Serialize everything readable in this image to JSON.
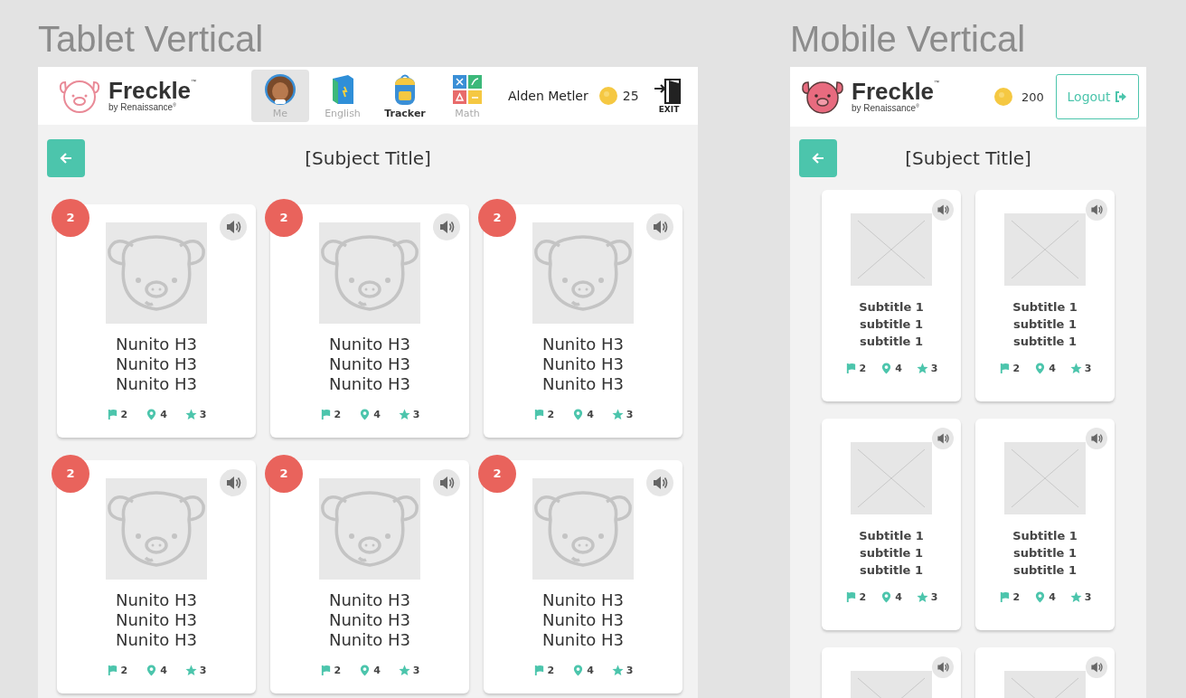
{
  "tablet": {
    "heading": "Tablet Vertical",
    "logo": {
      "kind": "outline",
      "name": "Freckle",
      "mark": "$^{™}$",
      "tagline": "by Renaissance$^{®}$"
    },
    "nav": [
      {
        "kind": "avatar",
        "label": "Me",
        "selected": true,
        "emphasized": false
      },
      {
        "kind": "book",
        "label": "English",
        "selected": false,
        "emphasized": false
      },
      {
        "kind": "backpack",
        "label": "Tracker",
        "selected": false,
        "emphasized": true
      },
      {
        "kind": "math",
        "label": "Math",
        "selected": false,
        "emphasized": false
      }
    ],
    "user_name": "Alden Metler",
    "coins": "25",
    "exit_label": "EXIT",
    "title": "[Subject Title]",
    "cards": [
      {
        "badge": "2",
        "lines": [
          "Nunito H3",
          "Nunito H3",
          "Nunito H3"
        ],
        "stats": [
          {
            "kind": "flag",
            "value": "2"
          },
          {
            "kind": "pin",
            "value": "4"
          },
          {
            "kind": "star",
            "value": "3"
          }
        ]
      },
      {
        "badge": "2",
        "lines": [
          "Nunito H3",
          "Nunito H3",
          "Nunito H3"
        ],
        "stats": [
          {
            "kind": "flag",
            "value": "2"
          },
          {
            "kind": "pin",
            "value": "4"
          },
          {
            "kind": "star",
            "value": "3"
          }
        ]
      },
      {
        "badge": "2",
        "lines": [
          "Nunito H3",
          "Nunito H3",
          "Nunito H3"
        ],
        "stats": [
          {
            "kind": "flag",
            "value": "2"
          },
          {
            "kind": "pin",
            "value": "4"
          },
          {
            "kind": "star",
            "value": "3"
          }
        ]
      },
      {
        "badge": "2",
        "lines": [
          "Nunito H3",
          "Nunito H3",
          "Nunito H3"
        ],
        "stats": [
          {
            "kind": "flag",
            "value": "2"
          },
          {
            "kind": "pin",
            "value": "4"
          },
          {
            "kind": "star",
            "value": "3"
          }
        ]
      },
      {
        "badge": "2",
        "lines": [
          "Nunito H3",
          "Nunito H3",
          "Nunito H3"
        ],
        "stats": [
          {
            "kind": "flag",
            "value": "2"
          },
          {
            "kind": "pin",
            "value": "4"
          },
          {
            "kind": "star",
            "value": "3"
          }
        ]
      },
      {
        "badge": "2",
        "lines": [
          "Nunito H3",
          "Nunito H3",
          "Nunito H3"
        ],
        "stats": [
          {
            "kind": "flag",
            "value": "2"
          },
          {
            "kind": "pin",
            "value": "4"
          },
          {
            "kind": "star",
            "value": "3"
          }
        ]
      }
    ]
  },
  "mobile": {
    "heading": "Mobile Vertical",
    "logo": {
      "kind": "filled",
      "name": "Freckle",
      "mark": "$^{™}$",
      "tagline": "by Renaissance$^{®}$"
    },
    "coins": "200",
    "logout_label": "Logout",
    "title": "[Subject Title]",
    "cards": [
      {
        "kind": "subtitled",
        "lines": [
          "Subtitle 1",
          "subtitle 1",
          "subtitle 1"
        ],
        "stats": [
          {
            "kind": "flag",
            "value": "2"
          },
          {
            "kind": "pin",
            "value": "4"
          },
          {
            "kind": "star",
            "value": "3"
          }
        ]
      },
      {
        "kind": "subtitled",
        "lines": [
          "Subtitle 1",
          "subtitle 1",
          "subtitle 1"
        ],
        "stats": [
          {
            "kind": "flag",
            "value": "2"
          },
          {
            "kind": "pin",
            "value": "4"
          },
          {
            "kind": "star",
            "value": "3"
          }
        ]
      },
      {
        "kind": "subtitled",
        "lines": [
          "Subtitle 1",
          "subtitle 1",
          "subtitle 1"
        ],
        "stats": [
          {
            "kind": "flag",
            "value": "2"
          },
          {
            "kind": "pin",
            "value": "4"
          },
          {
            "kind": "star",
            "value": "3"
          }
        ]
      },
      {
        "kind": "subtitled",
        "lines": [
          "Subtitle 1",
          "subtitle 1",
          "subtitle 1"
        ],
        "stats": [
          {
            "kind": "flag",
            "value": "2"
          },
          {
            "kind": "pin",
            "value": "4"
          },
          {
            "kind": "star",
            "value": "3"
          }
        ]
      },
      {
        "kind": "image_only"
      },
      {
        "kind": "image_only"
      }
    ]
  }
}
